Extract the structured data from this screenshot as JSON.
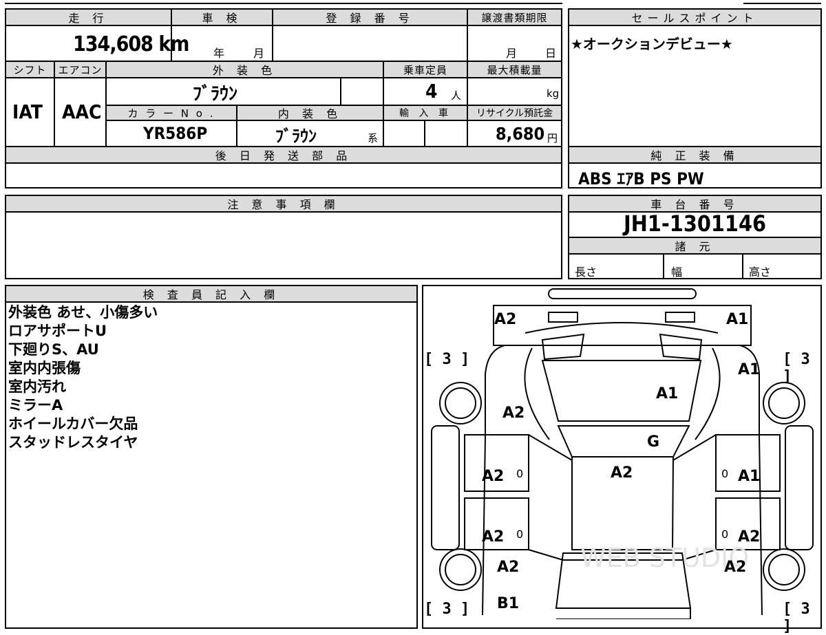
{
  "top_table": {
    "mileage_label": "走 行",
    "mileage_value": "134,608 km",
    "inspection_label": "車 検",
    "inspection_year": "年",
    "inspection_month": "月",
    "registration_label": "登 録 番 号",
    "transfer_label": "譲渡書類期限",
    "transfer_month": "月",
    "transfer_day": "日",
    "shift_label": "シフト",
    "shift_value": "IAT",
    "ac_label": "エアコン",
    "ac_value": "AAC",
    "exterior_label": "外 装 色",
    "exterior_value": "ﾌﾞﾗｳﾝ",
    "capacity_label": "乗車定員",
    "capacity_value": "4",
    "capacity_unit": "人",
    "load_label": "最大積載量",
    "load_unit": "kg",
    "color_no_label": "カ ラ ー N o .",
    "color_no_value": "YR586P",
    "interior_label": "内 装 色",
    "interior_value": "ﾌﾞﾗｳﾝ",
    "interior_suffix": "系",
    "import_label": "輸 入 車",
    "recycle_label": "リサイクル預託金",
    "recycle_value": "8,680",
    "recycle_unit": "円",
    "later_parts_label": "後 日 発 送 部 品"
  },
  "sales_point": {
    "label": "セールスポイント",
    "text": "★オークションデビュー★"
  },
  "equipment": {
    "label": "純 正 装 備",
    "text": "ABS ｴｱB PS PW"
  },
  "caution": {
    "label": "注 意 事 項 欄"
  },
  "chassis": {
    "label": "車 台 番 号",
    "value": "JH1-1301146",
    "specs_label": "諸 元",
    "length": "長さ",
    "width": "幅",
    "height": "高さ"
  },
  "inspector": {
    "label": "検 査 員 記 入 欄",
    "notes": [
      "外装色 あせ、小傷多い",
      "ロアサポートU",
      "下廻りS、AU",
      "室内内張傷",
      "室内汚れ",
      "ミラーA",
      "ホイールカバー欠品",
      "スタッドレスタイヤ"
    ]
  },
  "diagram": {
    "marks": {
      "front_left": "A2",
      "front_right": "A1",
      "fender_right": "A1",
      "hood": "A1",
      "fender_left": "A2",
      "windshield": "G",
      "roof": "A2",
      "front_door_left": "A2",
      "front_door_right": "A1",
      "rear_door_left": "A2",
      "rear_door_right": "A2",
      "quarter_left": "A2",
      "quarter_right": "A2",
      "rear_bottom": "B1",
      "door_zero_1": "0",
      "door_zero_2": "0",
      "door_zero_3": "0",
      "door_zero_4": "0"
    },
    "tire_tl": "[ 3 ]",
    "tire_tr": "[ 3 ]",
    "tire_bl": "[ 3 ]",
    "tire_br": "[ 3 ]",
    "watermark": "WEB STUDIO"
  }
}
